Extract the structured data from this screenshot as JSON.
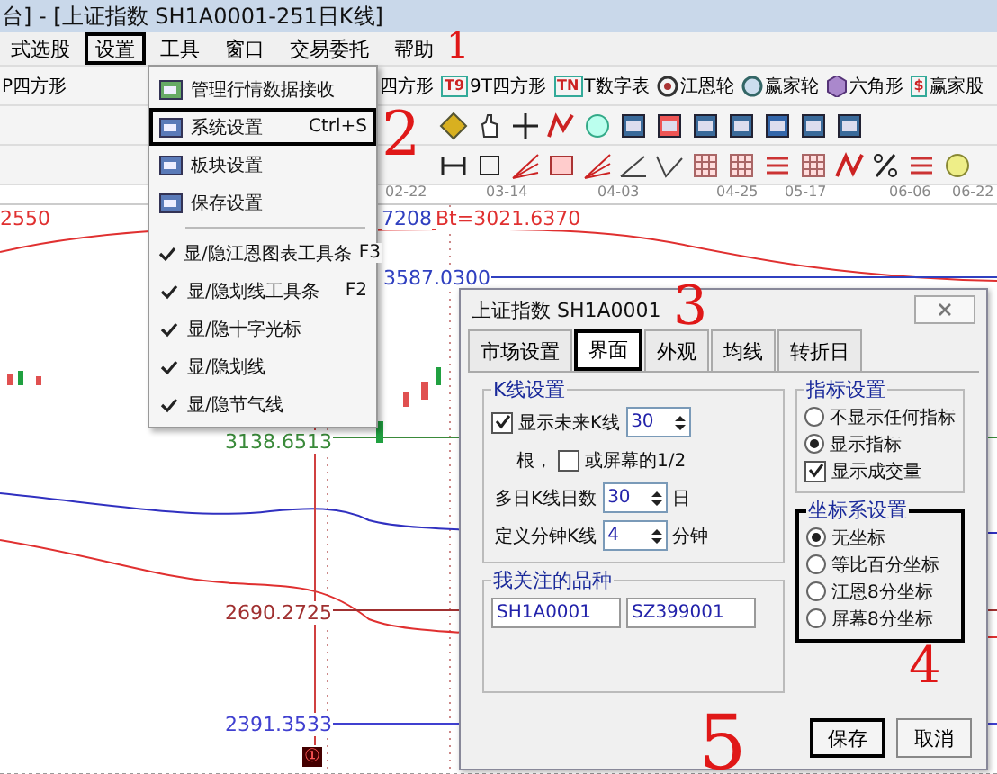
{
  "window": {
    "title": "台] - [上证指数  SH1A0001-251日K线]"
  },
  "menu_bar": [
    {
      "label": "式选股",
      "outlined": false
    },
    {
      "label": "设置",
      "outlined": true
    },
    {
      "label": "工具",
      "outlined": false
    },
    {
      "label": "窗口",
      "outlined": false
    },
    {
      "label": "交易委托",
      "outlined": false
    },
    {
      "label": "帮助",
      "outlined": false
    }
  ],
  "toolbar": [
    {
      "kind": "plain",
      "label": "P四方形"
    },
    {
      "kind": "plain",
      "label": "四方形"
    },
    {
      "kind": "badge",
      "badge": "T9",
      "label": "9T四方形"
    },
    {
      "kind": "badge",
      "badge": "TN",
      "label": "T数字表"
    },
    {
      "kind": "target",
      "label": "江恩轮"
    },
    {
      "kind": "ring",
      "label": "赢家轮"
    },
    {
      "kind": "hexagon",
      "label": "六角形"
    },
    {
      "kind": "badge",
      "badge": "$",
      "label": "赢家股"
    }
  ],
  "date_axis": [
    "02-22",
    "03-14",
    "04-03",
    "04-25",
    "05-17",
    "06-06",
    "06-22"
  ],
  "chart_labels": [
    {
      "text": "2550",
      "color": "#e03030"
    },
    {
      "text": "7208",
      "color": "#3040c0"
    },
    {
      "text": "Bt=3021.6370",
      "color": "#e03030"
    },
    {
      "text": "3587.0300",
      "color": "#3040c0"
    },
    {
      "text": "3138.6513",
      "color": "#3a8a3a"
    },
    {
      "text": "2690.2725",
      "color": "#a03030"
    },
    {
      "text": "2391.3533",
      "color": "#4040d0"
    }
  ],
  "chart_marker": "①",
  "settings_menu": [
    {
      "kind": "icon",
      "label": "管理行情数据接收",
      "outlined": false
    },
    {
      "kind": "icon",
      "label": "系统设置",
      "shortcut": "Ctrl+S",
      "outlined": true
    },
    {
      "kind": "icon",
      "label": "板块设置",
      "outlined": false
    },
    {
      "kind": "icon",
      "label": "保存设置",
      "outlined": false
    },
    {
      "kind": "separator"
    },
    {
      "kind": "check",
      "label": "显/隐江恩图表工具条",
      "shortcut": "F3",
      "checked": true
    },
    {
      "kind": "check",
      "label": "显/隐划线工具条",
      "shortcut": "F2",
      "checked": true
    },
    {
      "kind": "check",
      "label": "显/隐十字光标",
      "checked": true
    },
    {
      "kind": "check",
      "label": "显/隐划线",
      "checked": true
    },
    {
      "kind": "check",
      "label": "显/隐节气线",
      "checked": true
    }
  ],
  "dialog": {
    "title": "上证指数  SH1A0001",
    "tabs": [
      {
        "label": "市场设置",
        "selected": false,
        "outlined": false
      },
      {
        "label": "界面",
        "selected": true,
        "outlined": true
      },
      {
        "label": "外观",
        "selected": false,
        "outlined": false
      },
      {
        "label": "均线",
        "selected": false,
        "outlined": false
      },
      {
        "label": "转折日",
        "selected": false,
        "outlined": false
      }
    ],
    "kline": {
      "title": "K线设置",
      "show_future": {
        "label": "显示未来K线",
        "checked": true,
        "value": "30"
      },
      "prefix": "根，",
      "half_screen": {
        "label": "或屏幕的1/2",
        "checked": false
      },
      "days": {
        "label": "多日K线日数",
        "value": "30",
        "unit": "日"
      },
      "minutes": {
        "label": "定义分钟K线",
        "value": "4",
        "unit": "分钟"
      }
    },
    "indicator": {
      "title": "指标设置",
      "options": [
        {
          "kind": "radio",
          "label": "不显示任何指标",
          "selected": false
        },
        {
          "kind": "radio",
          "label": "显示指标",
          "selected": true
        },
        {
          "kind": "check",
          "label": "显示成交量",
          "checked": true
        }
      ]
    },
    "axis": {
      "title": "坐标系设置",
      "outlined": true,
      "options": [
        {
          "label": "无坐标",
          "selected": true
        },
        {
          "label": "等比百分坐标",
          "selected": false
        },
        {
          "label": "江恩8分坐标",
          "selected": false
        },
        {
          "label": "屏幕8分坐标",
          "selected": false
        }
      ]
    },
    "watch": {
      "title": "我关注的品种",
      "fields": [
        "SH1A0001",
        "SZ399001"
      ]
    },
    "buttons": [
      {
        "label": "保存",
        "outlined": true
      },
      {
        "label": "取消",
        "outlined": false
      }
    ]
  },
  "annotations": [
    {
      "label": "1"
    },
    {
      "label": "2"
    },
    {
      "label": "3"
    },
    {
      "label": "4"
    },
    {
      "label": "5"
    }
  ]
}
